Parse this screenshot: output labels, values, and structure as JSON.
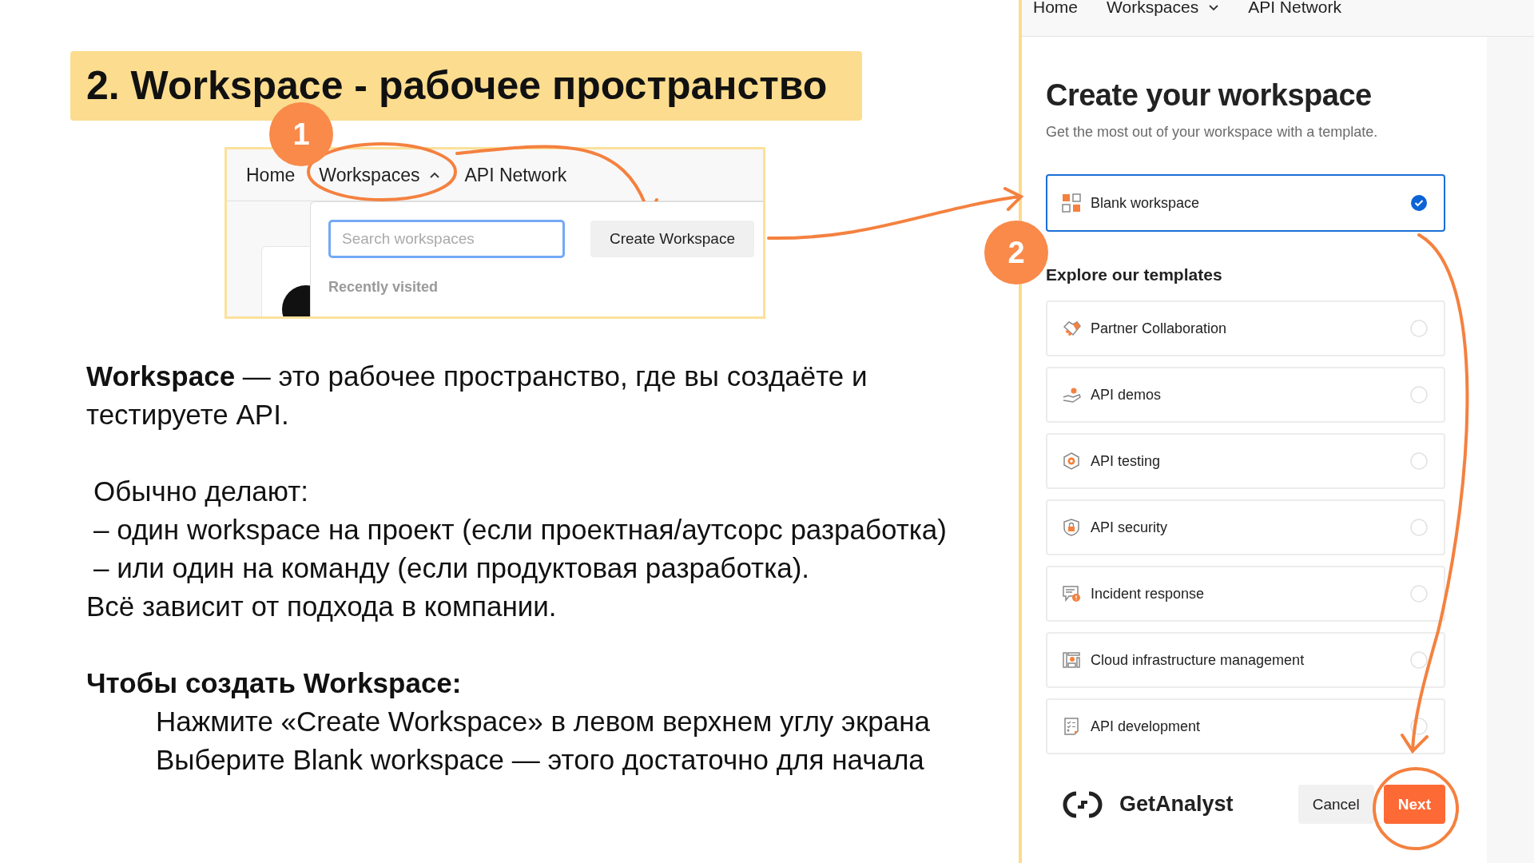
{
  "slide_title": "2. Workspace - рабочее пространство",
  "dropdown_screenshot": {
    "nav": {
      "home": "Home",
      "workspaces": {
        "label": "Workspaces",
        "expanded": true
      },
      "api_network": "API Network"
    },
    "search": {
      "placeholder": "Search workspaces"
    },
    "create_button": "Create Workspace",
    "section_label": "Recently visited"
  },
  "body": {
    "intro": "**Workspace** — это рабочее пространство, где вы создаёте и тестируете API.",
    "usage_heading": "Обычно делают:",
    "usage_items": [
      "– один workspace на проект (если проектная/аутсорс разработка)",
      "– или один на команду (если продуктовая разработка)."
    ],
    "usage_note": "Всё зависит от подхода в компании.",
    "steps_heading": "Чтобы создать Workspace:",
    "steps": [
      "Нажмите «Create Workspace» в левом верхнем углу экрана",
      "Выберите Blank workspace — этого достаточно для начала"
    ]
  },
  "step_markers": [
    "1",
    "2"
  ],
  "create_dialog": {
    "nav": {
      "home": "Home",
      "workspaces": {
        "label": "Workspaces",
        "expanded": false
      },
      "api_network": "API Network"
    },
    "title": "Create your workspace",
    "subtitle": "Get the most out of your workspace with a template.",
    "blank_option": {
      "label": "Blank workspace",
      "selected": true
    },
    "templates_heading": "Explore our templates",
    "templates": [
      {
        "label": "Partner Collaboration",
        "kind": "handshake",
        "selected": false
      },
      {
        "label": "API demos",
        "kind": "hand",
        "selected": false
      },
      {
        "label": "API testing",
        "kind": "gear",
        "selected": false
      },
      {
        "label": "API security",
        "kind": "shield",
        "selected": false
      },
      {
        "label": "Incident response",
        "kind": "alert",
        "selected": false
      },
      {
        "label": "Cloud infrastructure management",
        "kind": "server",
        "selected": false
      },
      {
        "label": "API development",
        "kind": "checklist",
        "selected": false
      }
    ],
    "brand": "GetAnalyst",
    "buttons": {
      "cancel": "Cancel",
      "next": "Next"
    }
  }
}
